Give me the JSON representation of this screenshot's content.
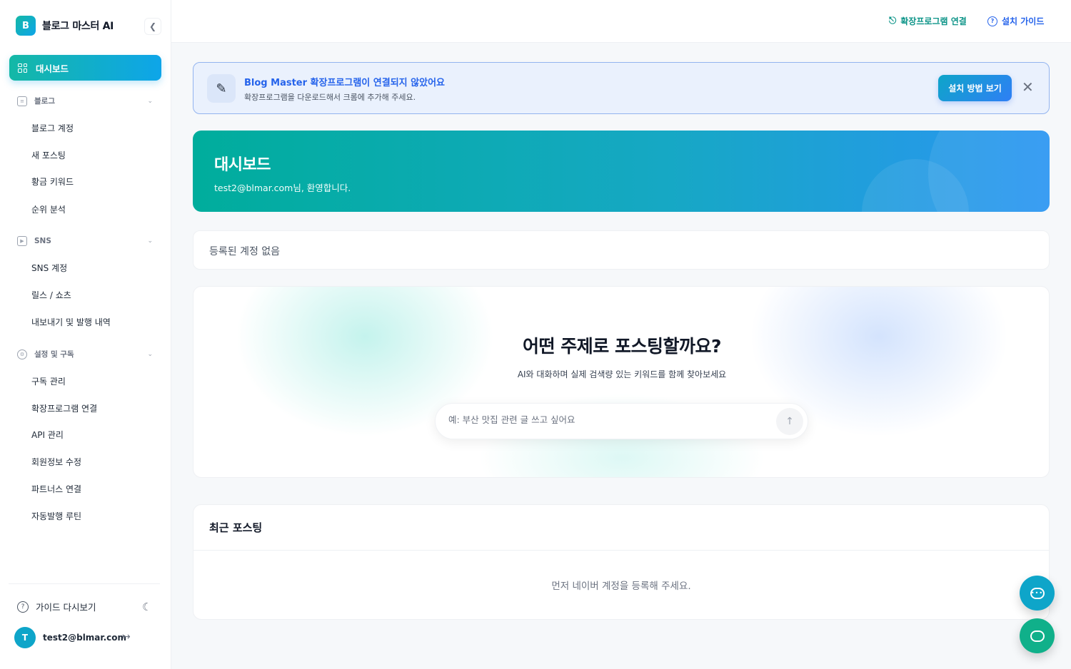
{
  "brand": {
    "logo_letter": "B",
    "name": "블로그 마스터 AI"
  },
  "sidebar": {
    "active_item": "대시보드",
    "groups": [
      {
        "label": "블로그",
        "items": [
          "블로그 계정",
          "새 포스팅",
          "황금 키워드",
          "순위 분석"
        ]
      },
      {
        "label": "SNS",
        "items": [
          "SNS 계정",
          "릴스 / 쇼츠",
          "내보내기 및 발행 내역"
        ]
      },
      {
        "label": "설정 및 구독",
        "items": [
          "구독 관리",
          "확장프로그램 연결",
          "API 관리",
          "회원정보 수정",
          "파트너스 연결",
          "자동발행 루틴"
        ]
      }
    ],
    "guide_label": "가이드 다시보기",
    "user": {
      "avatar_letter": "T",
      "email": "test2@blmar.com"
    }
  },
  "topbar": {
    "extension_link": "확장프로그램 연결",
    "guide_link": "설치 가이드"
  },
  "banner": {
    "title": "Blog Master 확장프로그램이 연결되지 않았어요",
    "description": "확장프로그램을 다운로드해서 크롬에 추가해 주세요.",
    "button": "설치 방법 보기"
  },
  "hero": {
    "title": "대시보드",
    "subtitle": "test2@blmar.com님, 환영합니다."
  },
  "account_status": "등록된 계정 없음",
  "prompt": {
    "title": "어떤 주제로 포스팅할까요?",
    "subtitle": "AI와 대화하며 실제 검색량 있는 키워드를 함께 찾아보세요",
    "placeholder": "예: 부산 맛집 관련 글 쓰고 싶어요"
  },
  "recent": {
    "title": "최근 포스팅",
    "empty_message": "먼저 네이버 계정을 등록해 주세요."
  },
  "colors": {
    "primary_teal": "#14b8a6",
    "primary_blue": "#0ea5e9",
    "link_blue": "#2563eb"
  }
}
